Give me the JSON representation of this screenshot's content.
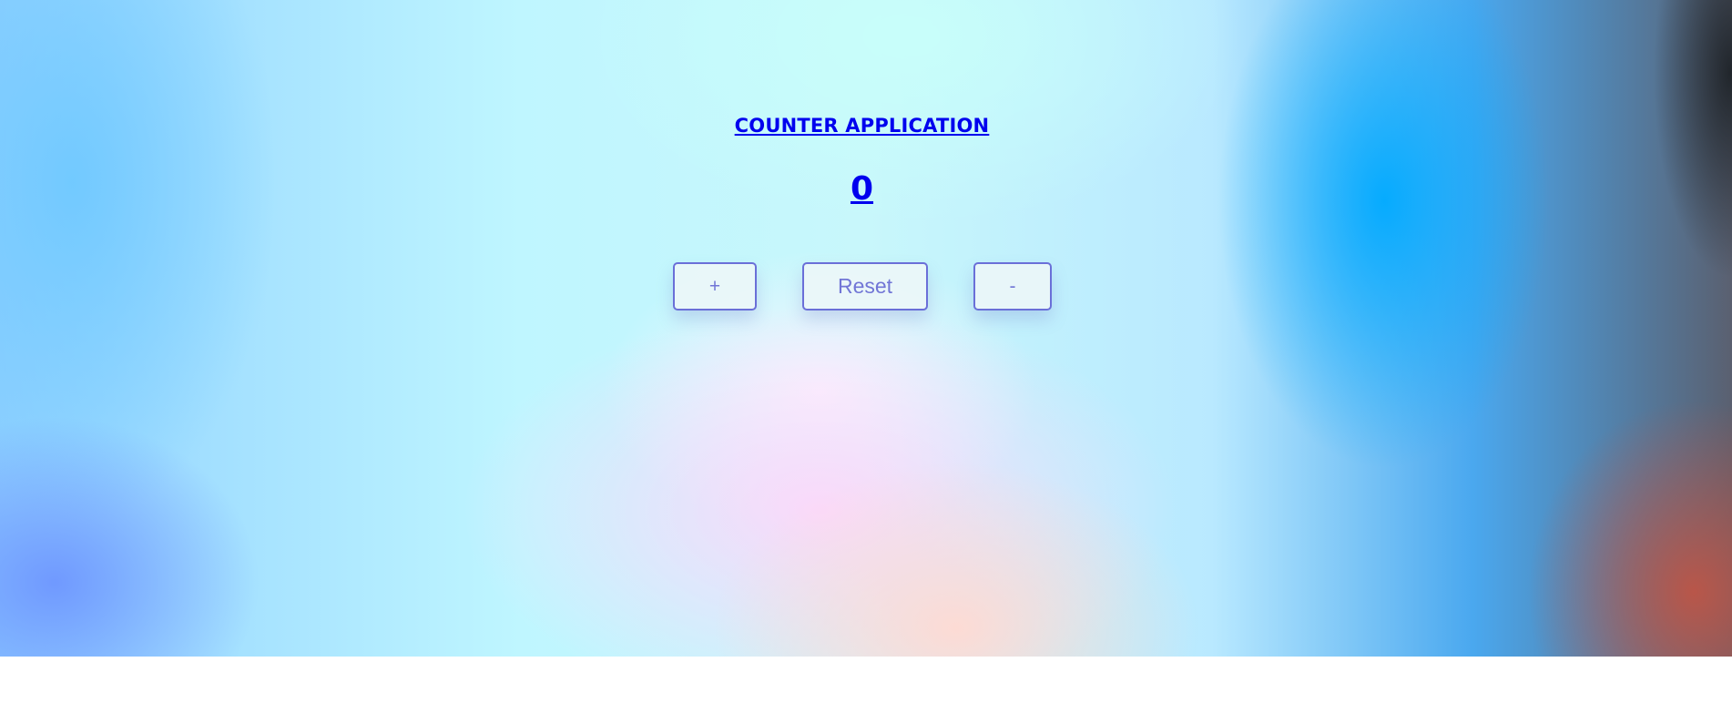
{
  "app": {
    "title": "COUNTER APPLICATION",
    "count": "0"
  },
  "buttons": {
    "increment_label": "+",
    "reset_label": "Reset",
    "decrement_label": "-"
  },
  "colors": {
    "link_blue": "#0000ee",
    "button_border": "#6a6fd8",
    "button_text": "#7176d6"
  }
}
